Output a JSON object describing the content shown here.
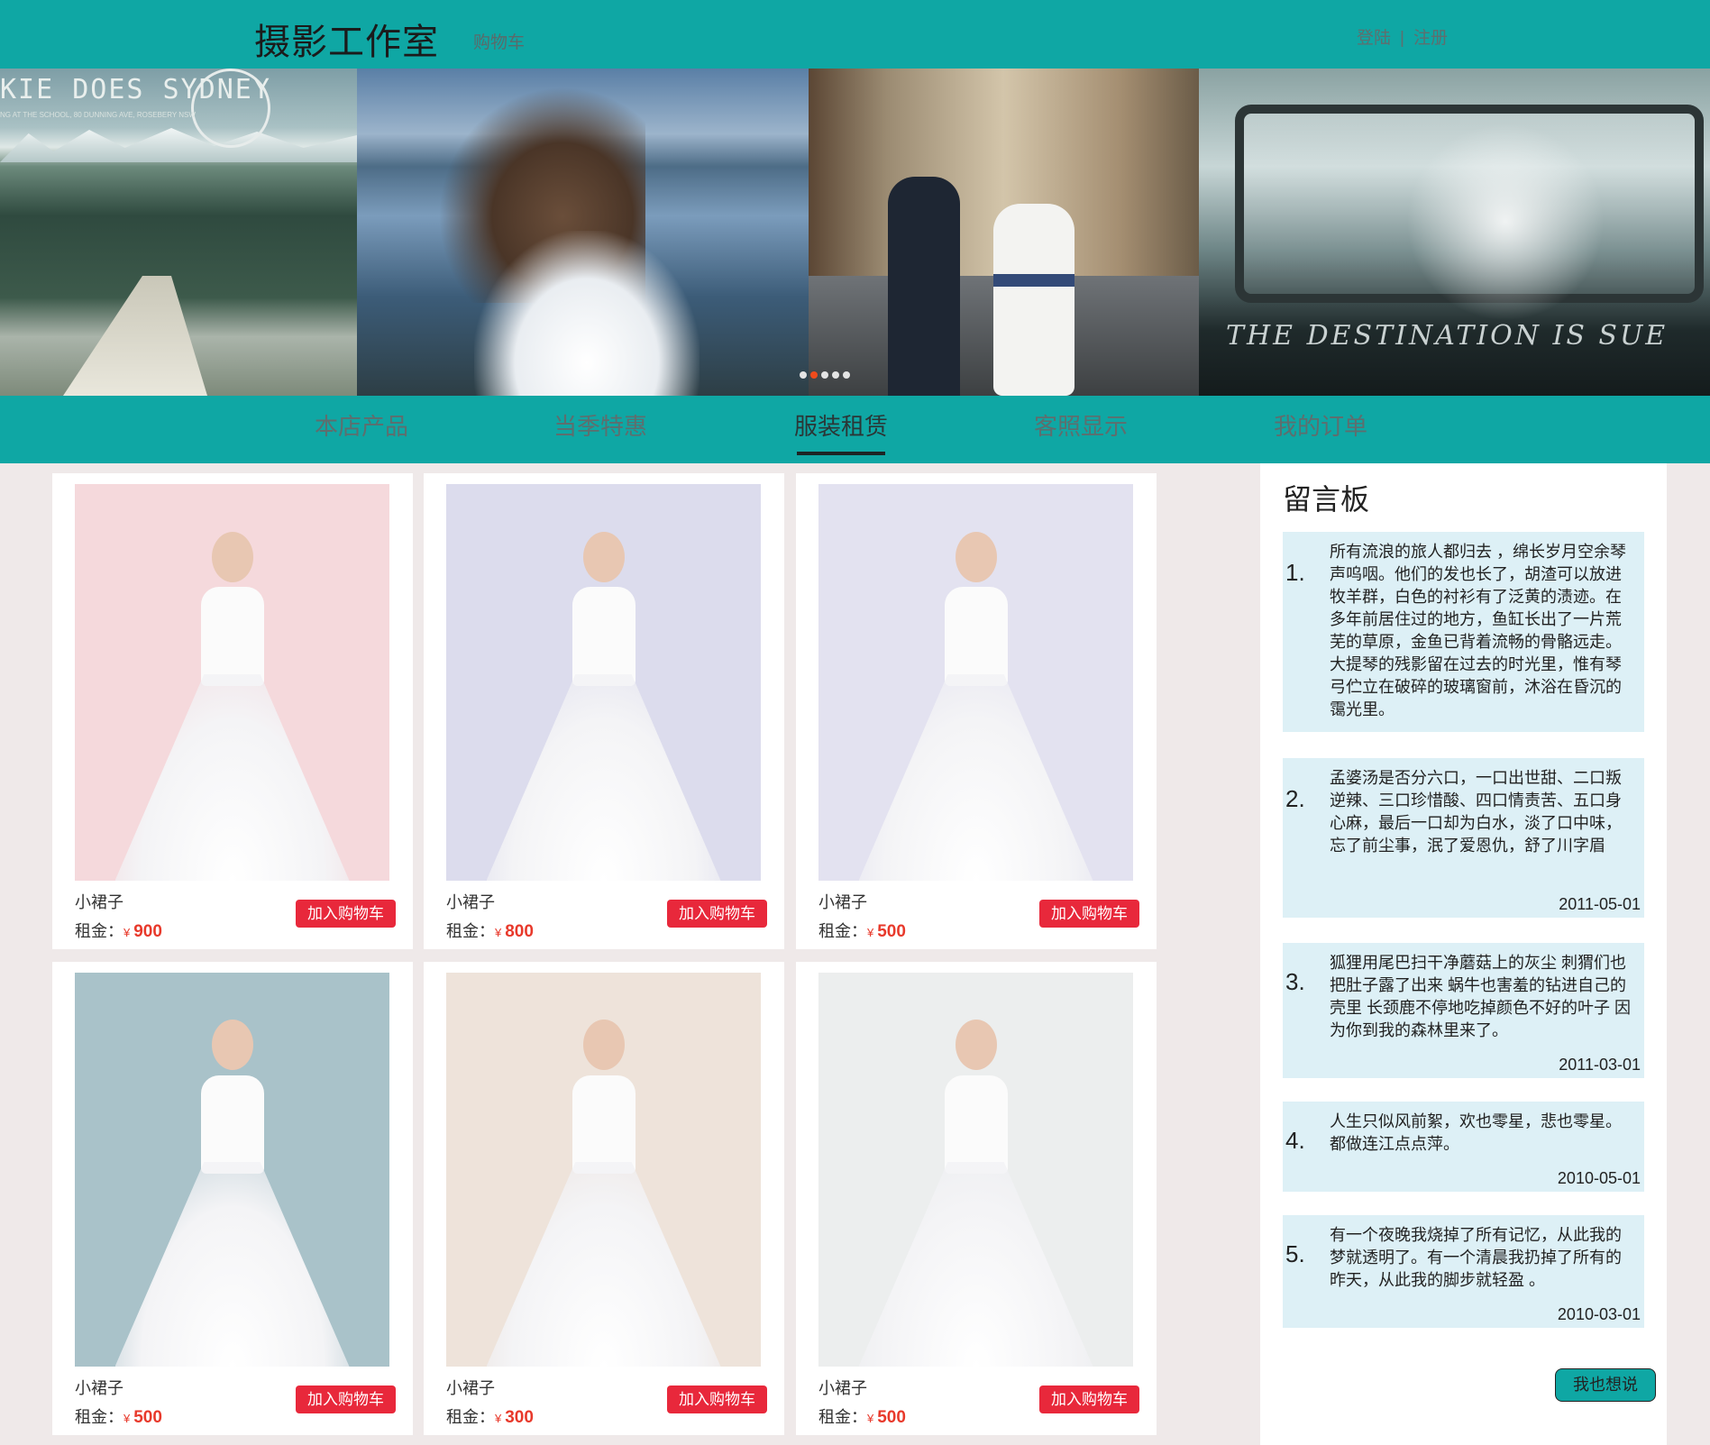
{
  "header": {
    "brand": "摄影工作室",
    "cart_link": "购物车",
    "login": "登陆",
    "separator": "|",
    "register": "注册",
    "colors": {
      "teal": "#0fa7a4",
      "red": "#e8283b"
    }
  },
  "banner": {
    "slide1_text": "KIE DOES SYDNEY",
    "slide1_subtext": "NG AT THE SCHOOL, 80 DUNNING AVE, ROSEBERY NSW",
    "slide4_text": "THE DESTINATION IS SUE",
    "carousel_dots": 5,
    "active_dot": 2
  },
  "nav": {
    "items": [
      {
        "label": "本店产品"
      },
      {
        "label": "当季特惠"
      },
      {
        "label": "服装租赁"
      },
      {
        "label": "客照显示"
      },
      {
        "label": "我的订单"
      }
    ],
    "active_index": 2
  },
  "products": {
    "items": [
      {
        "name": "小裙子",
        "price_label": "租金：",
        "currency": "¥",
        "price": "900",
        "button": "加入购物车",
        "bg": "#f5d9dc"
      },
      {
        "name": "小裙子",
        "price_label": "租金：",
        "currency": "¥",
        "price": "800",
        "button": "加入购物车",
        "bg": "#dcdced"
      },
      {
        "name": "小裙子",
        "price_label": "租金：",
        "currency": "¥",
        "price": "500",
        "button": "加入购物车",
        "bg": "#e3e2f0"
      },
      {
        "name": "小裙子",
        "price_label": "租金：",
        "currency": "¥",
        "price": "500",
        "button": "加入购物车",
        "bg": "#a9c2c9"
      },
      {
        "name": "小裙子",
        "price_label": "租金：",
        "currency": "¥",
        "price": "300",
        "button": "加入购物车",
        "bg": "#eee3da"
      },
      {
        "name": "小裙子",
        "price_label": "租金：",
        "currency": "¥",
        "price": "500",
        "button": "加入购物车",
        "bg": "#eceeee"
      }
    ]
  },
  "board": {
    "title": "留言板",
    "messages": [
      {
        "num": "1.",
        "text": "所有流浪的旅人都归去 ，绵长岁月空余琴声呜咽。他们的发也长了，胡渣可以放进牧羊群，白色的衬衫有了泛黄的渍迹。在多年前居住过的地方，鱼缸长出了一片荒芜的草原，金鱼已背着流畅的骨骼远走。大提琴的残影留在过去的时光里，惟有琴弓伫立在破碎的玻璃窗前，沐浴在昏沉的霭光里。",
        "date": ""
      },
      {
        "num": "2.",
        "text": "孟婆汤是否分六口，一口出世甜、二口叛逆辣、三口珍惜酸、四口情责苦、五口身心麻，最后一口却为白水，淡了口中味，忘了前尘事，泯了爱恩仇，舒了川字眉",
        "date": "2011-05-01"
      },
      {
        "num": "3.",
        "text": "狐狸用尾巴扫干净蘑菇上的灰尘 刺猬们也把肚子露了出来 蜗牛也害羞的钻进自己的壳里 长颈鹿不停地吃掉颜色不好的叶子 因为你到我的森林里来了。",
        "date": "2011-03-01"
      },
      {
        "num": "4.",
        "text": "人生只似风前絮，欢也零星，悲也零星。都做连江点点萍。",
        "date": "2010-05-01"
      },
      {
        "num": "5.",
        "text": "有一个夜晚我烧掉了所有记忆，从此我的梦就透明了。有一个清晨我扔掉了所有的昨天，从此我的脚步就轻盈 。",
        "date": "2010-03-01"
      }
    ],
    "say_button": "我也想说"
  }
}
